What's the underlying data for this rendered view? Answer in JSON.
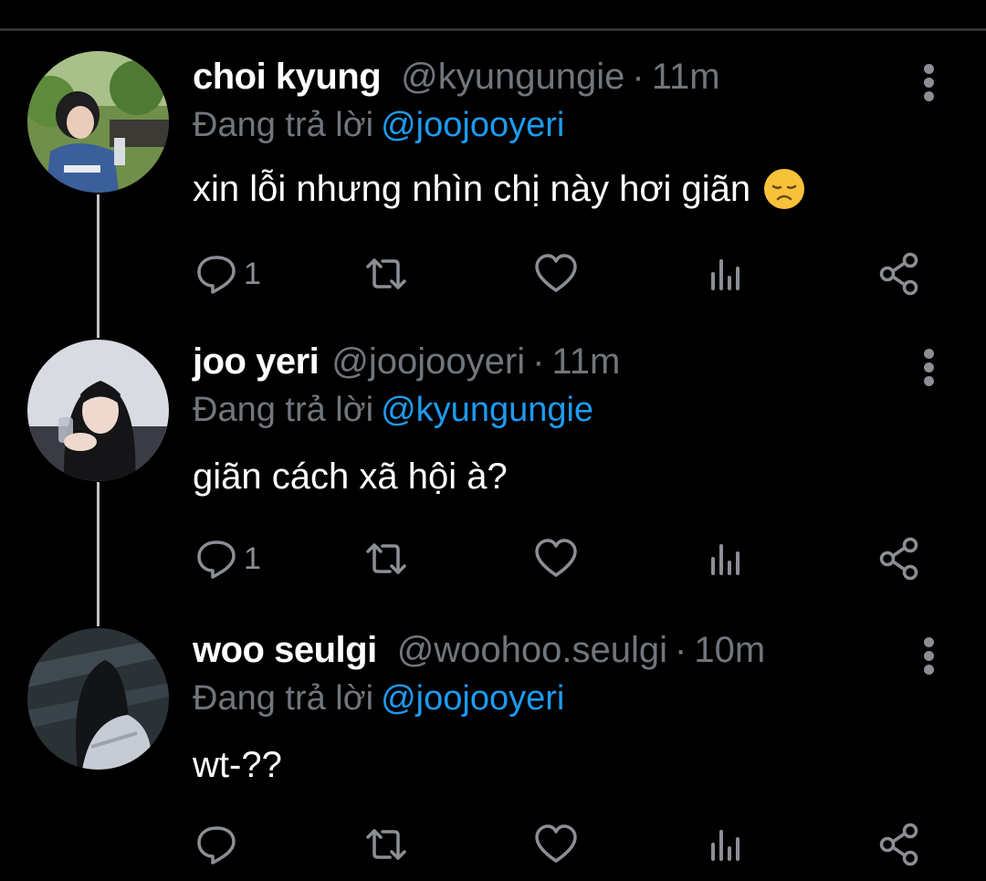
{
  "replying_prefix": "Đang trả lời",
  "tweets": [
    {
      "name": "choi kyung",
      "handle": "@kyungungie",
      "separator": "·",
      "time": "11m",
      "replying_to": "@joojooyeri",
      "text": "xin lỗi nhưng nhìn chị này hơi giãn",
      "emoji": "disappointed-face",
      "reply_count": "1"
    },
    {
      "name": "joo yeri",
      "handle": "@joojooyeri",
      "separator": "·",
      "time": "11m",
      "replying_to": "@kyungungie",
      "text": "giãn cách xã hội à?",
      "reply_count": "1"
    },
    {
      "name": "woo seulgi",
      "handle": "@woohoo.seulgi",
      "separator": "·",
      "time": "10m",
      "replying_to": "@joojooyeri",
      "text": "wt-??",
      "reply_count": ""
    }
  ],
  "colors": {
    "background": "#000000",
    "text": "#ffffff",
    "muted": "#71767b",
    "mention": "#1d9bf0",
    "icon": "#8b8f93",
    "thread_line": "#c4c4c4"
  }
}
